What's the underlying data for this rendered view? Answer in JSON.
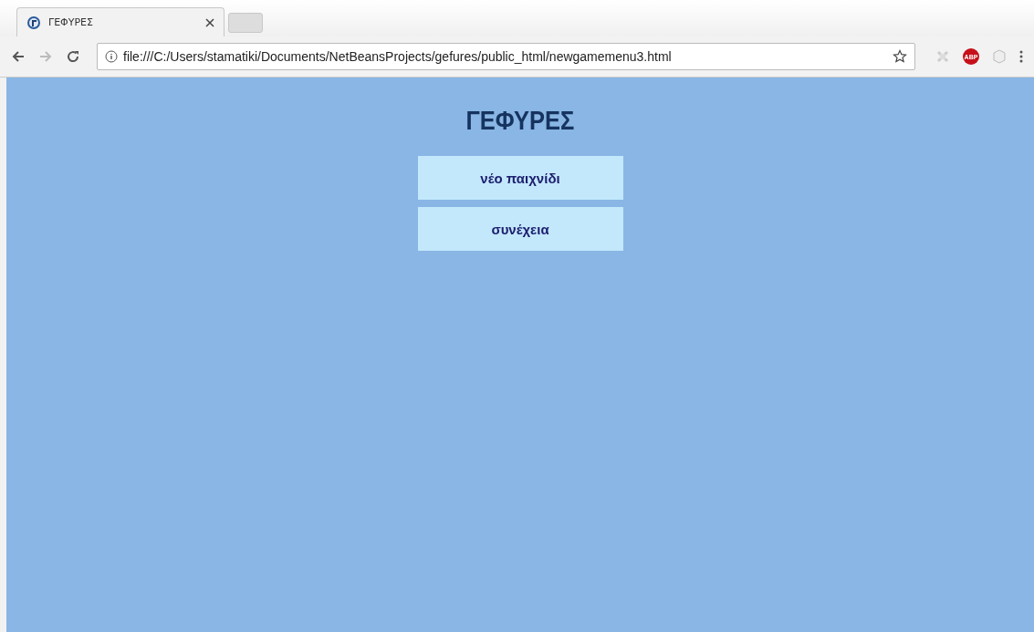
{
  "browser": {
    "tab": {
      "title": "ΓΕΦΥΡΕΣ"
    },
    "address": "file:///C:/Users/stamatiki/Documents/NetBeansProjects/gefures/public_html/newgamemenu3.html",
    "extension_badge": "ABP"
  },
  "page": {
    "heading": "ΓΕΦΥΡΕΣ",
    "buttons": [
      {
        "label": "νέο παιχνίδι"
      },
      {
        "label": "συνέχεια"
      }
    ]
  }
}
